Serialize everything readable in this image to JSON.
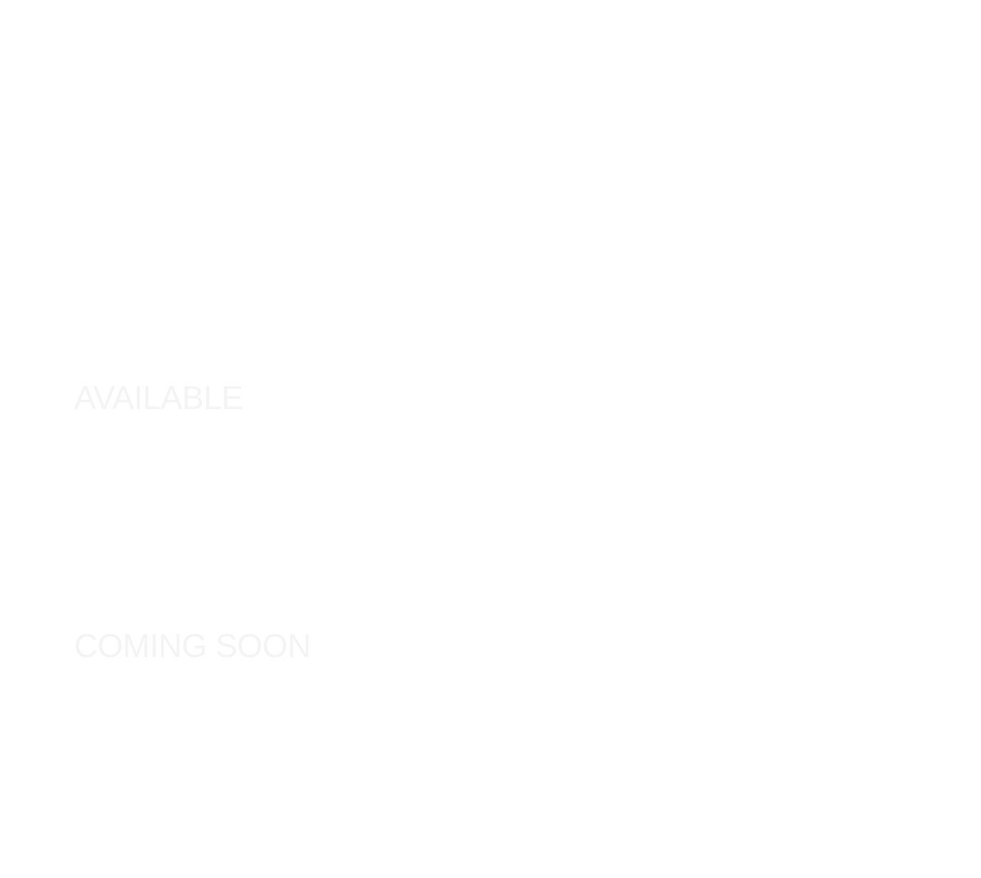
{
  "sections": {
    "available": {
      "heading": "AVAILABLE"
    },
    "coming_soon": {
      "heading": "COMING SOON"
    }
  },
  "colors": {
    "background": "#ffffff",
    "heading_text": "#f4f4f5"
  }
}
